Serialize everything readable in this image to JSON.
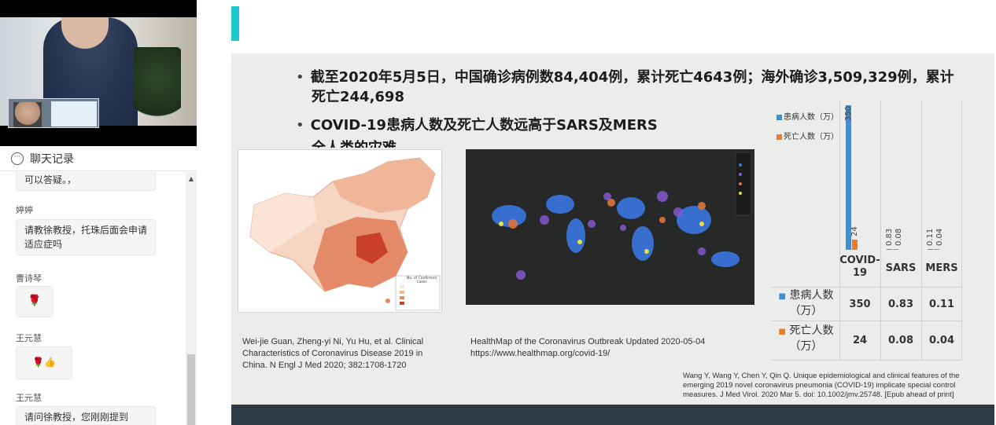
{
  "chat": {
    "header_title": "聊天记录",
    "messages": [
      {
        "name": "",
        "text": "可以答疑。，"
      },
      {
        "name": "婷婷",
        "text": "请教徐教授，托珠后面会申请适应症吗"
      },
      {
        "name": "曹诗琴",
        "text": "🌹"
      },
      {
        "name": "王元慧",
        "text": "🌹👍"
      },
      {
        "name": "王元慧",
        "text": "请问徐教授，您刚刚提到"
      }
    ]
  },
  "slide": {
    "bullet1": "截至2020年5月5日，中国确诊病例数84,404例，累计死亡4643例；海外确诊3,509,329例，累计",
    "bullet1_cont": "死亡244,698",
    "bullet2": "COVID-19患病人数及死亡人数远高于SARS及MERS",
    "bullet3_partial": "全人类的灾难",
    "caption_china": "Wei-jie Guan, Zheng-yi Ni, Yu Hu, et al. Clinical Characteristics of Coronavirus Disease 2019 in China. N Engl J Med 2020; 382:1708-1720",
    "caption_world": "HealthMap of the Coronavirus Outbreak Updated 2020-05-04",
    "caption_world_url": "https://www.healthmap.org/covid-19/",
    "reference": "Wang Y, Wang Y, Chen Y, Qin Q. Unique epidemiological and clinical features of the emerging 2019 novel coronavirus pneumonia (COVID-19) implicate special control measures. J Med Virol. 2020 Mar 5. doi: 10.1002/jmv.25748. [Epub ahead of print]",
    "china_map_legend_title": "No. of Confirmed Cases"
  },
  "chart_data": {
    "type": "bar",
    "categories": [
      "COVID-19",
      "SARS",
      "MERS"
    ],
    "series": [
      {
        "name": "患病人数（万）",
        "values": [
          350,
          0.83,
          0.11
        ],
        "color": "#3d8fd6"
      },
      {
        "name": "死亡人数（万）",
        "values": [
          24,
          0.08,
          0.04
        ],
        "color": "#f07a23"
      }
    ],
    "value_labels": [
      [
        "350",
        "0.83",
        "0.11"
      ],
      [
        "24",
        "0.08",
        "0.04"
      ]
    ],
    "row_headers": [
      "患病人数（万）",
      "死亡人数（万）"
    ],
    "ylim": [
      0,
      350
    ],
    "legend_position": "top-left",
    "grid": true
  },
  "colors": {
    "accent": "#1fc8cc",
    "slide_bg": "#ebedea",
    "footer_bar": "#2d3b45",
    "series_blue": "#3d8fd6",
    "series_orange": "#f07a23"
  }
}
